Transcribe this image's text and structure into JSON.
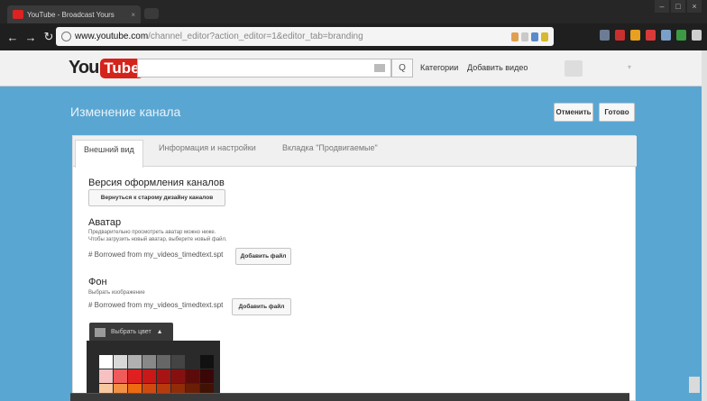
{
  "browser": {
    "tab_title": "YouTube - Broadcast Yours",
    "url_host": "www.youtube.com",
    "url_rest": "/channel_editor?action_editor=1&editor_tab=branding"
  },
  "header": {
    "logo_you": "You",
    "logo_tube": "Tube",
    "search_placeholder": "",
    "search_icon": "Q",
    "link_categories": "Категории",
    "link_upload": "Добавить видео"
  },
  "editor": {
    "title": "Изменение канала",
    "cancel_label": "Отменить",
    "done_label": "Готово",
    "tabs": [
      "Внешний вид",
      "Информация и настройки",
      "Вкладка \"Продвигаемые\""
    ],
    "version": {
      "title": "Версия оформления каналов",
      "button": "Вернуться к старому дизайну каналов"
    },
    "avatar": {
      "title": "Аватар",
      "hint1": "Предварительно просмотреть аватар можно ниже.",
      "hint2": "Чтобы загрузить новый аватар, выберите новый файл.",
      "file": "# Borrowed from my_videos_timedtext.spt",
      "button": "Добавить файл"
    },
    "background": {
      "title": "Фон",
      "hint": "Выбрать изображение",
      "file": "# Borrowed from my_videos_timedtext.spt",
      "button": "Добавить файл"
    },
    "color_picker": {
      "label": "Выбрать цвет",
      "caret": "▲"
    }
  },
  "colors": {
    "banner": "#5aa6d2",
    "youtube_red": "#d4231b",
    "palette": [
      "#ffffff",
      "#d8d8d8",
      "#b0b0b0",
      "#888888",
      "#666666",
      "#444444",
      "#2a2a2a",
      "#111111",
      "#f6c1c1",
      "#ef5a5a",
      "#e02020",
      "#c81818",
      "#a81414",
      "#861010",
      "#5c0b0b",
      "#3a0606",
      "#f8c8a0",
      "#f29046",
      "#ec6a10",
      "#d04a10",
      "#b83a0c",
      "#902c08",
      "#6a1e06",
      "#401204"
    ]
  }
}
